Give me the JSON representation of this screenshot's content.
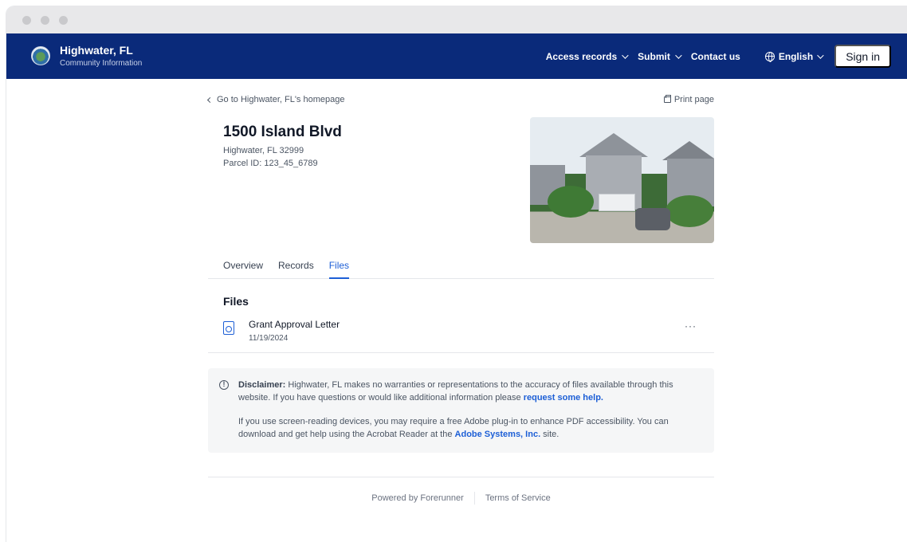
{
  "window": {
    "controls": [
      "close",
      "minimize",
      "zoom"
    ]
  },
  "navbar": {
    "brand_title": "Highwater, FL",
    "brand_subtitle": "Community Information",
    "links": [
      {
        "label": "Access records",
        "dropdown": true
      },
      {
        "label": "Submit",
        "dropdown": true
      },
      {
        "label": "Contact us",
        "dropdown": false
      }
    ],
    "language": "English",
    "signin_label": "Sign in",
    "colors": {
      "background": "#0a2a7a",
      "accent": "#1d5fd6"
    }
  },
  "page": {
    "back_link": "Go to Highwater, FL's homepage",
    "print_label": "Print page",
    "address": "1500 Island Blvd",
    "city_line": "Highwater, FL 32999",
    "parcel": "Parcel ID: 123_45_6789",
    "tabs": [
      {
        "label": "Overview",
        "active": false
      },
      {
        "label": "Records",
        "active": false
      },
      {
        "label": "Files",
        "active": true
      }
    ],
    "files_title": "Files",
    "files": [
      {
        "name": "Grant Approval Letter",
        "date": "11/19/2024",
        "more": "···"
      }
    ],
    "disclaimer": {
      "label": "Disclaimer:",
      "text1": " Highwater, FL makes no warranties or representations to the accuracy of files available through this website. If you have questions or would like additional information please ",
      "link1": "request some help.",
      "text2": "If you use screen-reading devices, you may require a free Adobe plug-in to enhance PDF accessibility. You can download and get help using the Acrobat Reader at the ",
      "link2": "Adobe Systems, Inc.",
      "text2_end": " site."
    }
  },
  "footer": {
    "powered_by": "Powered by Forerunner",
    "terms": "Terms of Service"
  }
}
